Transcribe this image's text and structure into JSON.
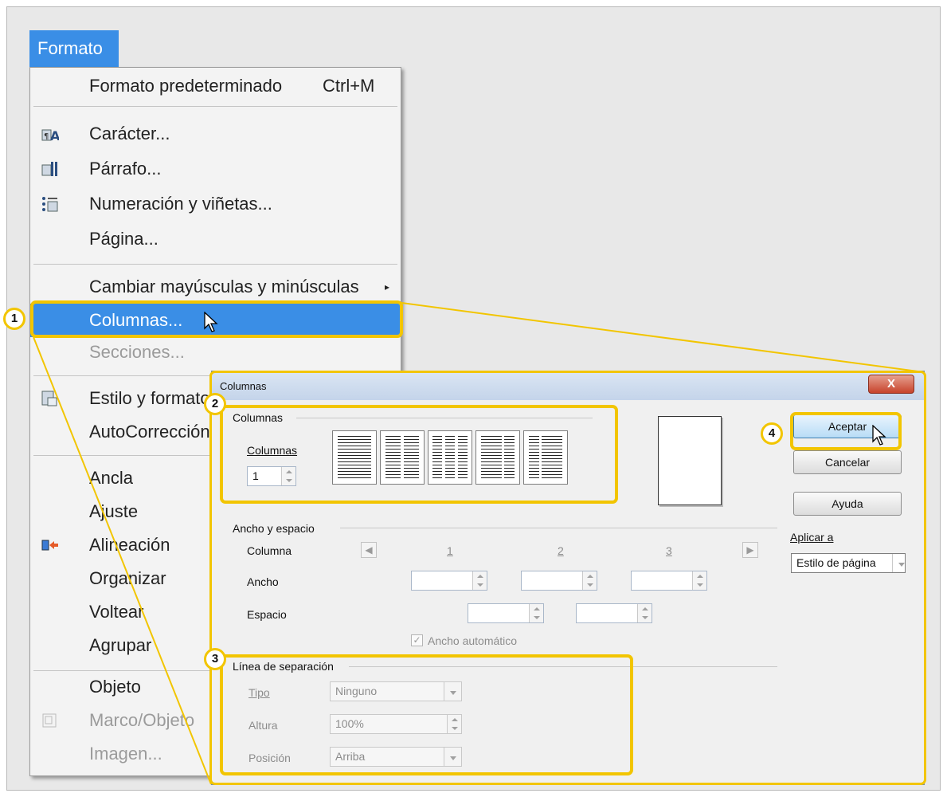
{
  "menu": {
    "title": "Formato",
    "items": [
      {
        "label": "Formato predeterminado",
        "shortcut": "Ctrl+M"
      },
      {
        "label": "Carácter...",
        "icon": "character-icon"
      },
      {
        "label": "Párrafo...",
        "icon": "paragraph-icon"
      },
      {
        "label": "Numeración y viñetas...",
        "icon": "bullets-numbering-icon"
      },
      {
        "label": "Página..."
      },
      {
        "label": "Cambiar mayúsculas y minúsculas",
        "submenu": "▸"
      },
      {
        "label": "Columnas..."
      },
      {
        "label": "Secciones..."
      },
      {
        "label": "Estilo y formato",
        "icon": "styles-icon"
      },
      {
        "label": "AutoCorrección"
      },
      {
        "label": "Ancla"
      },
      {
        "label": "Ajuste"
      },
      {
        "label": "Alineación",
        "icon": "alignment-icon"
      },
      {
        "label": "Organizar"
      },
      {
        "label": "Voltear"
      },
      {
        "label": "Agrupar"
      },
      {
        "label": "Objeto"
      },
      {
        "label": "Marco/Objeto",
        "icon": "frame-object-icon"
      },
      {
        "label": "Imagen..."
      }
    ]
  },
  "dialog": {
    "title": "Columnas",
    "close": "X",
    "section_columns": "Columnas",
    "columns_label": "Columnas",
    "columns_value": "1",
    "section_width": "Ancho y espacio",
    "row_column": "Columna",
    "row_width": "Ancho",
    "row_space": "Espacio",
    "col_numbers": [
      "1",
      "2",
      "3"
    ],
    "auto_width": "Ancho automático",
    "section_separator": "Línea de separación",
    "type_label": "Tipo",
    "type_value": "Ninguno",
    "height_label": "Altura",
    "height_value": "100%",
    "position_label": "Posición",
    "position_value": "Arriba",
    "apply_label": "Aplicar a",
    "apply_value": "Estilo de página",
    "ok": "Aceptar",
    "cancel": "Cancelar",
    "help": "Ayuda"
  },
  "callouts": [
    "1",
    "2",
    "3",
    "4"
  ],
  "colors": {
    "highlight": "#3a8ee6",
    "callout": "#f2c500"
  }
}
